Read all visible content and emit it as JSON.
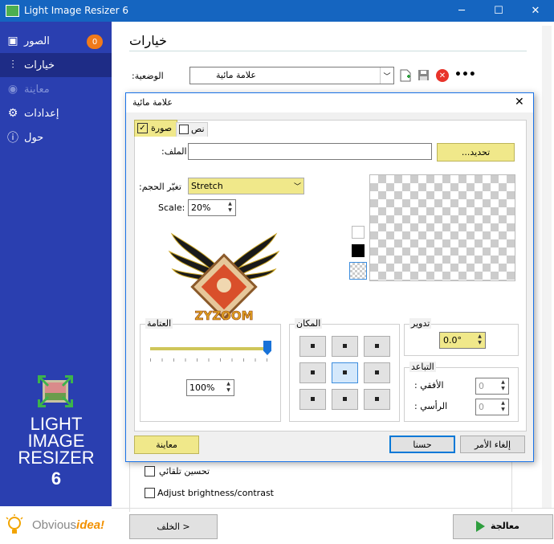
{
  "window": {
    "title": "Light Image Resizer 6",
    "minimize": "─",
    "maximize": "☐",
    "close": "✕"
  },
  "sidebar": {
    "items": [
      {
        "label": "الصور",
        "icon": "images-icon",
        "glyph": "▣",
        "badge": "0"
      },
      {
        "label": "خيارات",
        "icon": "sliders-icon",
        "glyph": "⫶"
      },
      {
        "label": "معاينة",
        "icon": "eye-icon",
        "glyph": "◉"
      },
      {
        "label": "إعدادات",
        "icon": "gear-icon",
        "glyph": "⚙"
      },
      {
        "label": "حول",
        "icon": "info-icon",
        "glyph": "ⓘ"
      }
    ],
    "logo": {
      "line1": "LIGHT",
      "line2": "IMAGE",
      "line3": "RESIZER",
      "version": "6"
    },
    "brand": {
      "obvious": "Obvious",
      "idea": "idea!"
    }
  },
  "main": {
    "header": "خيارات",
    "mode_label": ":الوضعية",
    "mode_value": "علامة مائية",
    "auto_enhance": "تحسين تلقائي",
    "brightness": "Adjust brightness/contrast",
    "back_button": "الخلف >",
    "process_button": "معالجة"
  },
  "dialog": {
    "title": "علامة مائية",
    "tab_image": "صورة",
    "tab_text": "نص",
    "file_label": ":الملف",
    "file_value": "",
    "browse_button": "...تحديد",
    "resize_label": ":تغيّر الحجم",
    "resize_value": "Stretch",
    "scale_label": "Scale:",
    "scale_value": "20%",
    "watermark_text": "ZYZOOM",
    "opacity_group": "العتامة",
    "opacity_value": "100%",
    "opacity_level": 1.0,
    "position_group": "المكان",
    "rotation_group": "تدوير",
    "rotation_value": "0.0°",
    "spacing_group": "التباعد",
    "horizontal_label": ": الأفقي",
    "horizontal_value": "0",
    "vertical_label": ": الرأسي",
    "vertical_value": "0",
    "preview_button": "معاينة",
    "ok_button": "حسنا",
    "cancel_button": "إلغاء الأمر"
  },
  "colors": {
    "accent": "#1565c0",
    "sidebar": "#2a3fb0",
    "highlight": "#f0e88a",
    "badge": "#f07a1a",
    "process": "#2e9e3e"
  }
}
